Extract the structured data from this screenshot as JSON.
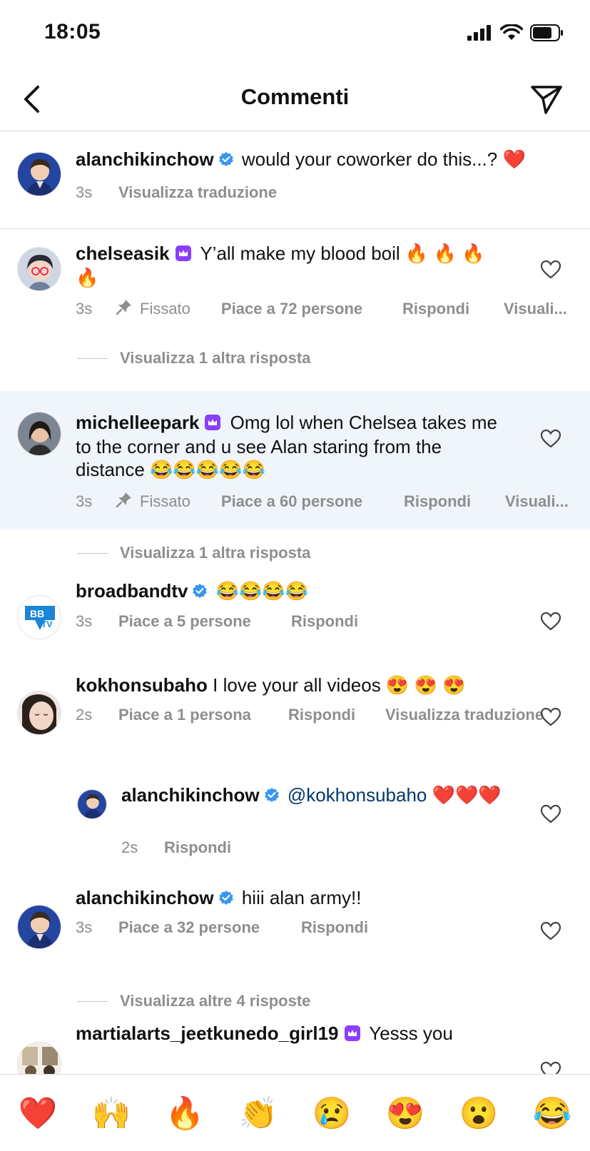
{
  "status": {
    "time": "18:05"
  },
  "nav": {
    "title": "Commenti"
  },
  "caption": {
    "username": "alanchikinchow",
    "text": "would your coworker do this...? ❤️",
    "time": "3s",
    "translate": "Visualizza traduzione"
  },
  "comments": [
    {
      "username": "chelseasik",
      "text": "Y’all make my blood boil 🔥 🔥 🔥 🔥",
      "time": "3s",
      "pinned": "Fissato",
      "likes": "Piace a 72 persone",
      "reply": "Rispondi",
      "translate": "Visuali...",
      "more": "Visualizza 1 altra risposta"
    },
    {
      "username": "michelleepark",
      "text": "Omg lol when Chelsea takes me to the corner and u see Alan staring from the distance 😂😂😂😂😂",
      "time": "3s",
      "pinned": "Fissato",
      "likes": "Piace a 60 persone",
      "reply": "Rispondi",
      "translate": "Visuali...",
      "more": "Visualizza 1 altra risposta"
    },
    {
      "username": "broadbandtv",
      "text": "😂😂😂😂",
      "time": "3s",
      "likes": "Piace a 5 persone",
      "reply": "Rispondi"
    },
    {
      "username": "kokhonsubaho",
      "text": "I love your all videos 😍 😍 😍",
      "time": "2s",
      "likes": "Piace a 1 persona",
      "reply": "Rispondi",
      "translate": "Visualizza traduzione"
    },
    {
      "username": "alanchikinchow",
      "mention": "@kokhonsubaho",
      "text": "❤️❤️❤️",
      "time": "2s",
      "reply": "Rispondi"
    },
    {
      "username": "alanchikinchow",
      "text": "hiii alan army!!",
      "time": "3s",
      "likes": "Piace a 32 persone",
      "reply": "Rispondi",
      "more": "Visualizza altre 4 risposte"
    },
    {
      "username": "martialarts_jeetkunedo_girl19",
      "text": "Yesss you"
    }
  ],
  "emoji_bar": [
    "❤️",
    "🙌",
    "🔥",
    "👏",
    "😢",
    "😍",
    "😮",
    "😂"
  ],
  "colors": {
    "verified": "#3897f0",
    "crown": "#8a3ffc",
    "highlight": "#eff5fb",
    "meta": "#8e8e8e",
    "mention": "#00376b"
  }
}
